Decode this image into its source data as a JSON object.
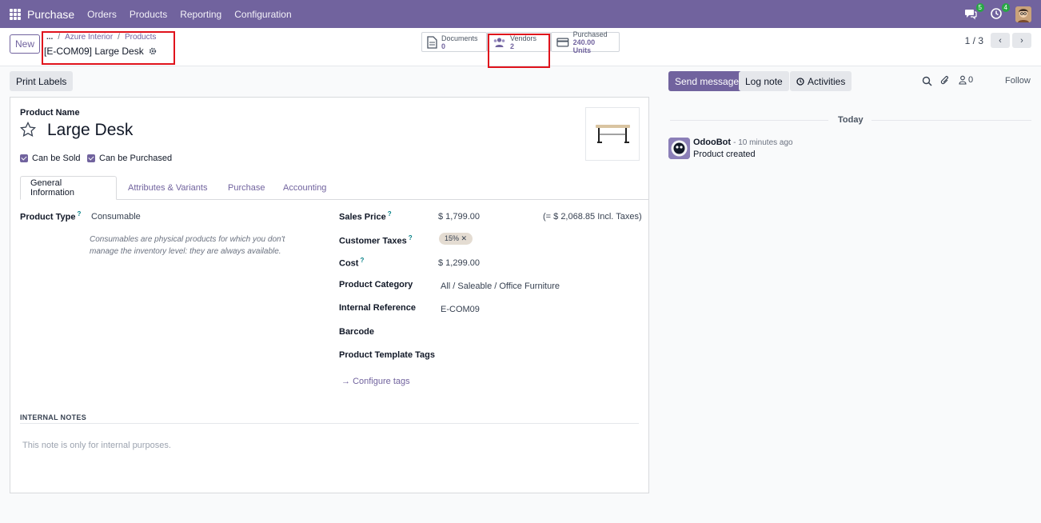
{
  "topbar": {
    "app_name": "Purchase",
    "menu": [
      "Orders",
      "Products",
      "Reporting",
      "Configuration"
    ],
    "messages_count": "5",
    "activities_count": "4"
  },
  "control": {
    "new_label": "New",
    "breadcrumb": [
      "...",
      "Azure Interior",
      "Products"
    ],
    "record_title": "[E-COM09] Large Desk",
    "smart_buttons": [
      {
        "label": "Documents",
        "value": "0",
        "icon": "file-icon"
      },
      {
        "label": "Vendors",
        "value": "2",
        "icon": "users-icon"
      },
      {
        "label": "Purchased",
        "value": "240.00 Units",
        "icon": "credit-card-icon"
      }
    ],
    "pager": "1 / 3"
  },
  "actions": {
    "print_labels": "Print Labels"
  },
  "form": {
    "product_name_label": "Product Name",
    "product_name": "Large Desk",
    "can_be_sold": "Can be Sold",
    "can_be_purchased": "Can be Purchased",
    "tabs": [
      "General Information",
      "Attributes & Variants",
      "Purchase",
      "Accounting"
    ],
    "product_type_label": "Product Type",
    "product_type": "Consumable",
    "product_type_help": "Consumables are physical products for which you don't manage the inventory level: they are always available.",
    "sales_price_label": "Sales Price",
    "sales_price": "$ 1,799.00",
    "incl_taxes": "(= $ 2,068.85 Incl. Taxes)",
    "customer_taxes_label": "Customer Taxes",
    "customer_tax_tag": "15%",
    "cost_label": "Cost",
    "cost": "$ 1,299.00",
    "category_label": "Product Category",
    "category": "All / Saleable / Office Furniture",
    "internal_ref_label": "Internal Reference",
    "internal_ref": "E-COM09",
    "barcode_label": "Barcode",
    "tags_label": "Product Template Tags",
    "configure_tags": "Configure tags",
    "internal_notes_label": "INTERNAL NOTES",
    "internal_notes_placeholder": "This note is only for internal purposes.",
    "help_mark": "?"
  },
  "chatter": {
    "send_message": "Send message",
    "log_note": "Log note",
    "activities": "Activities",
    "followers_count": "0",
    "follow": "Follow",
    "today": "Today",
    "author": "OdooBot",
    "time": "- 10 minutes ago",
    "message": "Product created"
  },
  "colors": {
    "brand": "#71639e",
    "highlight": "#e0131c"
  }
}
